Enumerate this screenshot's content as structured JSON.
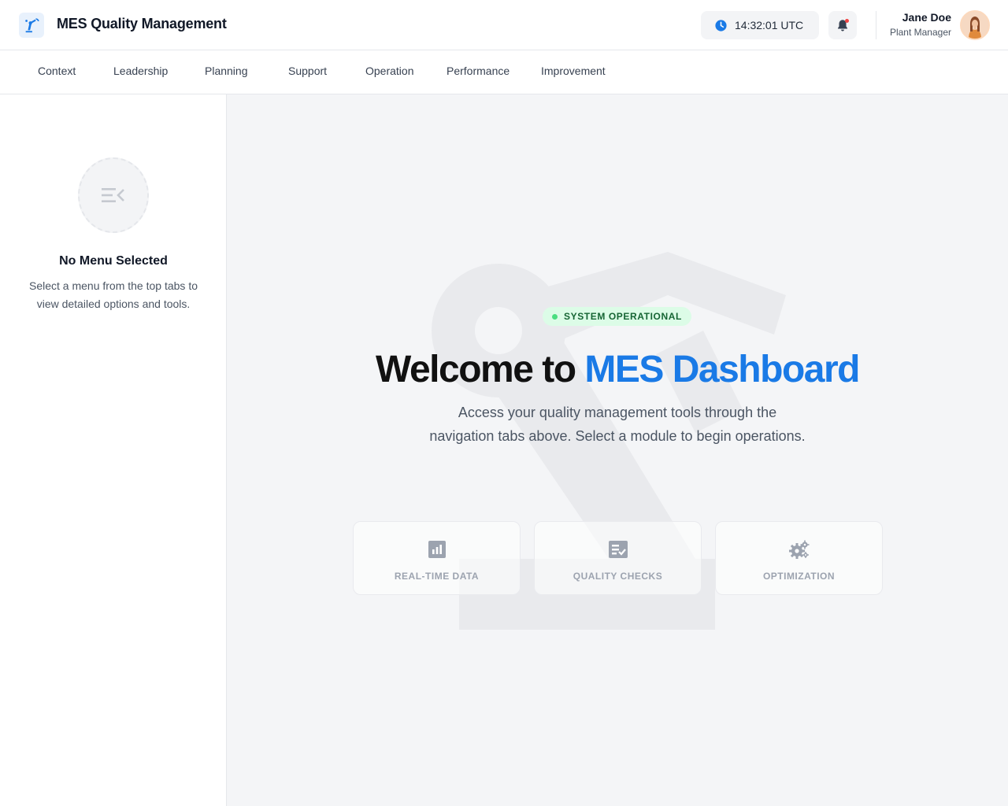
{
  "header": {
    "logo_icon": "robot-arm-icon",
    "app_title": "MES Quality Management",
    "clock": {
      "icon": "clock-icon",
      "time": "14:32:01 UTC"
    },
    "notifications": {
      "icon": "bell-icon",
      "has_unread": true
    },
    "user": {
      "name": "Jane Doe",
      "role": "Plant Manager",
      "avatar_icon": "user-avatar"
    }
  },
  "tabs": [
    {
      "label": "Context"
    },
    {
      "label": "Leadership"
    },
    {
      "label": "Planning"
    },
    {
      "label": "Support"
    },
    {
      "label": "Operation"
    },
    {
      "label": "Performance"
    },
    {
      "label": "Improvement"
    }
  ],
  "sidebar": {
    "empty_icon": "menu-collapse-icon",
    "title": "No Menu Selected",
    "text": "Select a menu from the top tabs to view detailed options and tools."
  },
  "main": {
    "status_badge": "SYSTEM OPERATIONAL",
    "welcome_prefix": "Welcome to",
    "welcome_highlight": "MES Dashboard",
    "intro": "Access your quality management tools through the navigation tabs above. Select a module to begin operations.",
    "features": [
      {
        "label": "REAL-TIME DATA",
        "icon": "bar-chart-icon"
      },
      {
        "label": "QUALITY CHECKS",
        "icon": "checklist-icon"
      },
      {
        "label": "OPTIMIZATION",
        "icon": "gears-icon"
      }
    ]
  },
  "colors": {
    "accent": "#1a7ae6",
    "status_green": "#166534",
    "status_bg": "#dcfce7",
    "notification_dot": "#ef4444"
  }
}
